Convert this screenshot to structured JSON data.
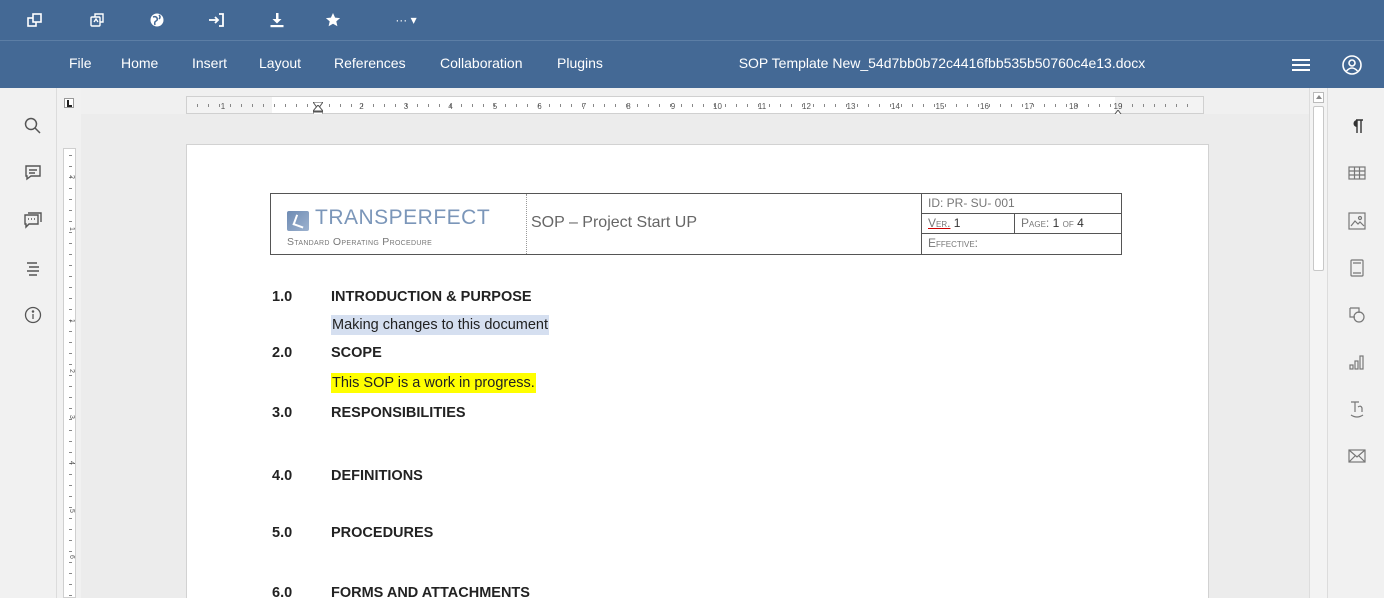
{
  "menu": {
    "items": [
      "File",
      "Home",
      "Insert",
      "Layout",
      "References",
      "Collaboration",
      "Plugins"
    ],
    "document_title": "SOP Template New_54d7bb0b72c4416fbb535b50760c4e13.docx"
  },
  "quickbar": {
    "more_label": "··· ▾"
  },
  "ruler": {
    "h_numbers": [
      "1",
      "1",
      "2",
      "3",
      "4",
      "5",
      "6",
      "7",
      "8",
      "9",
      "10",
      "11",
      "12",
      "13",
      "14",
      "15",
      "16",
      "17",
      "18",
      "19"
    ],
    "v_numbers": [
      "2",
      "1",
      "1",
      "2",
      "3",
      "4",
      "5",
      "6"
    ]
  },
  "header": {
    "logo_text": "TRANSPERFECT",
    "logo_subtitle": "Standard Operating Procedure",
    "title": "SOP – Project Start UP",
    "id": "ID: PR- SU- 001",
    "ver_label": "Ver.",
    "ver_value": "1",
    "page_label": "Page:",
    "page_value": "1",
    "page_of": "of",
    "page_total": "4",
    "effective_label": "Effective:"
  },
  "sections": [
    {
      "num": "1.0",
      "title": "INTRODUCTION & PURPOSE",
      "text": "Making changes to this document",
      "highlight": "#d5dff0"
    },
    {
      "num": "2.0",
      "title": "SCOPE",
      "text": "This SOP is a work in progress.",
      "highlight": "#ffff00"
    },
    {
      "num": "3.0",
      "title": "RESPONSIBILITIES",
      "text": ""
    },
    {
      "num": "4.0",
      "title": "DEFINITIONS",
      "text": ""
    },
    {
      "num": "5.0",
      "title": "PROCEDURES",
      "text": ""
    },
    {
      "num": "6.0",
      "title": "FORMS AND ATTACHMENTS",
      "text": ""
    }
  ],
  "colors": {
    "toolbar_bg": "#446995",
    "highlight_selection": "#d5dff0",
    "highlight_yellow": "#ffff00",
    "logo_blue": "#7b96b9"
  },
  "icons": {
    "quickbar": [
      "open-in-window-icon",
      "copy-style-icon",
      "globe-icon",
      "import-icon",
      "download-icon",
      "star-icon",
      "more-icon"
    ],
    "left_sidebar": [
      "search-icon",
      "comments-icon",
      "chat-icon",
      "navigation-icon",
      "info-icon"
    ],
    "right_sidebar": [
      "paragraph-icon",
      "table-icon",
      "image-icon",
      "header-footer-icon",
      "shape-icon",
      "chart-icon",
      "text-art-icon",
      "mail-merge-icon"
    ]
  }
}
